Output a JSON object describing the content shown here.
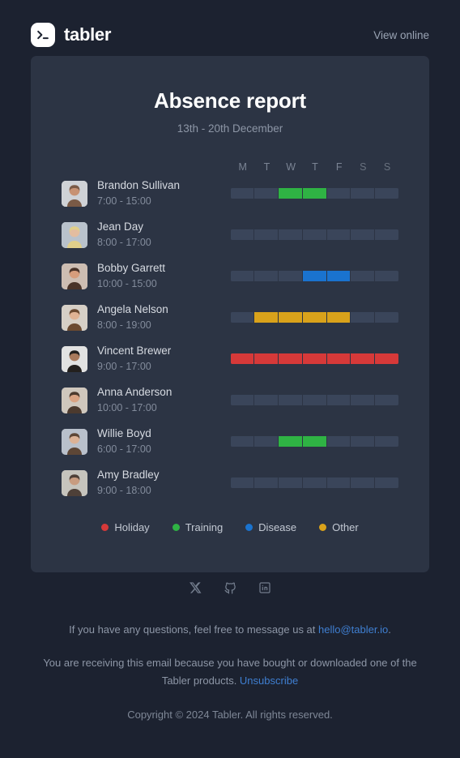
{
  "header": {
    "brand_name": "tabler",
    "logo_icon": "terminal-prompt-icon",
    "view_online_label": "View online"
  },
  "card": {
    "title": "Absence report",
    "subtitle": "13th - 20th December",
    "day_headers": [
      {
        "label": "M",
        "weekend": false
      },
      {
        "label": "T",
        "weekend": false
      },
      {
        "label": "W",
        "weekend": false
      },
      {
        "label": "T",
        "weekend": false
      },
      {
        "label": "F",
        "weekend": false
      },
      {
        "label": "S",
        "weekend": true
      },
      {
        "label": "S",
        "weekend": true
      }
    ],
    "rows": [
      {
        "name": "Brandon Sullivan",
        "time": "7:00 - 15:00",
        "days": [
          null,
          null,
          "training",
          "training",
          null,
          null,
          null
        ]
      },
      {
        "name": "Jean Day",
        "time": "8:00 - 17:00",
        "days": [
          null,
          null,
          null,
          null,
          null,
          null,
          null
        ]
      },
      {
        "name": "Bobby Garrett",
        "time": "10:00 - 15:00",
        "days": [
          null,
          null,
          null,
          "disease",
          "disease",
          null,
          null
        ]
      },
      {
        "name": "Angela Nelson",
        "time": "8:00 - 19:00",
        "days": [
          null,
          "other",
          "other",
          "other",
          "other",
          null,
          null
        ]
      },
      {
        "name": "Vincent Brewer",
        "time": "9:00 - 17:00",
        "days": [
          "holiday",
          "holiday",
          "holiday",
          "holiday",
          "holiday",
          "holiday",
          "holiday"
        ]
      },
      {
        "name": "Anna Anderson",
        "time": "10:00 - 17:00",
        "days": [
          null,
          null,
          null,
          null,
          null,
          null,
          null
        ]
      },
      {
        "name": "Willie Boyd",
        "time": "6:00 - 17:00",
        "days": [
          null,
          null,
          "training",
          "training",
          null,
          null,
          null
        ]
      },
      {
        "name": "Amy Bradley",
        "time": "9:00 - 18:00",
        "days": [
          null,
          null,
          null,
          null,
          null,
          null,
          null
        ]
      }
    ],
    "legend": [
      {
        "label": "Holiday",
        "key": "holiday",
        "color": "#d63939"
      },
      {
        "label": "Training",
        "key": "training",
        "color": "#2fb344"
      },
      {
        "label": "Disease",
        "key": "disease",
        "color": "#1a73cf"
      },
      {
        "label": "Other",
        "key": "other",
        "color": "#d9a21b"
      }
    ]
  },
  "footer": {
    "socials": [
      {
        "name": "x-twitter-icon"
      },
      {
        "name": "github-icon"
      },
      {
        "name": "linkedin-icon"
      }
    ],
    "questions_text_before": "If you have any questions, feel free to message us at ",
    "contact_email": "hello@tabler.io",
    "questions_text_after": ".",
    "reason_text_before": "You are receiving this email because you have bought or downloaded one of the Tabler products. ",
    "unsubscribe_label": "Unsubscribe",
    "copyright": "Copyright © 2024 Tabler. All rights reserved."
  },
  "colors": {
    "page_bg": "#1c2230",
    "card_bg": "#2c3444",
    "track": "#3a455a",
    "holiday": "#d63939",
    "training": "#2fb344",
    "disease": "#1a73cf",
    "other": "#d9a21b",
    "link": "#3f7fd1"
  }
}
